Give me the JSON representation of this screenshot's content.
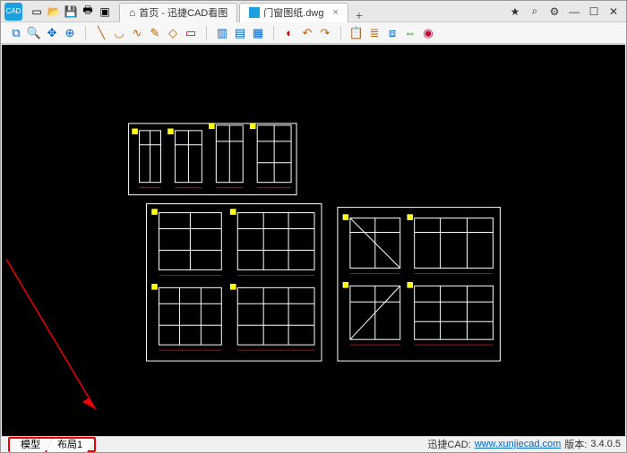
{
  "titlebar": {
    "quick": {
      "new": "new",
      "open": "open",
      "save": "save",
      "print": "print",
      "export": "export"
    },
    "tabs": [
      {
        "name": "home",
        "label": "首页 - 迅捷CAD看图",
        "active": false,
        "icon": "home"
      },
      {
        "name": "file",
        "label": "门窗图纸.dwg",
        "active": true,
        "icon": "file"
      }
    ],
    "close_glyph": "×",
    "add_glyph": "+"
  },
  "window_controls": {
    "bookmark": "★",
    "zoom": "⌕",
    "settings": "⚙",
    "min": "—",
    "max": "☐",
    "close": "✕"
  },
  "toolbar": {
    "nav": [
      "zoom-window",
      "zoom-extents",
      "pan",
      "zoom-realtime"
    ],
    "draw": [
      "line",
      "arc",
      "polyline",
      "pencil",
      "erase",
      "color"
    ],
    "box": [
      "rect-a",
      "rect-b",
      "rect-c"
    ],
    "edit": [
      "highlight",
      "undo",
      "redo"
    ],
    "misc": [
      "clipboard",
      "layers",
      "cube",
      "dim",
      "palette"
    ]
  },
  "bottom_tabs": [
    {
      "name": "model",
      "label": "模型"
    },
    {
      "name": "layout1",
      "label": "布局1"
    }
  ],
  "status": {
    "brand": "迅捷CAD:",
    "url": "www.xunjiecad.com",
    "version_label": "版本:",
    "version": "3.4.0.5"
  },
  "icons": {
    "home": "⌂",
    "file": "▤",
    "zoom-window": "⧉",
    "zoom-extents": "🔍",
    "pan": "✥",
    "zoom-realtime": "⊕",
    "line": "╲",
    "arc": "◡",
    "polyline": "∿",
    "pencil": "✎",
    "erase": "◇",
    "color": "▭",
    "rect-a": "▥",
    "rect-b": "▤",
    "rect-c": "▦",
    "highlight": "◐",
    "undo": "↶",
    "redo": "↷",
    "clipboard": "📋",
    "layers": "≣",
    "cube": "⧈",
    "dim": "⇔",
    "palette": "◉",
    "new": "▭",
    "open": "📂",
    "save": "💾",
    "print": "🖶",
    "export": "▣",
    "bookmark": "★",
    "zoom": "⌕",
    "settings": "⚙",
    "min": "—",
    "max": "☐",
    "close": "✕"
  }
}
